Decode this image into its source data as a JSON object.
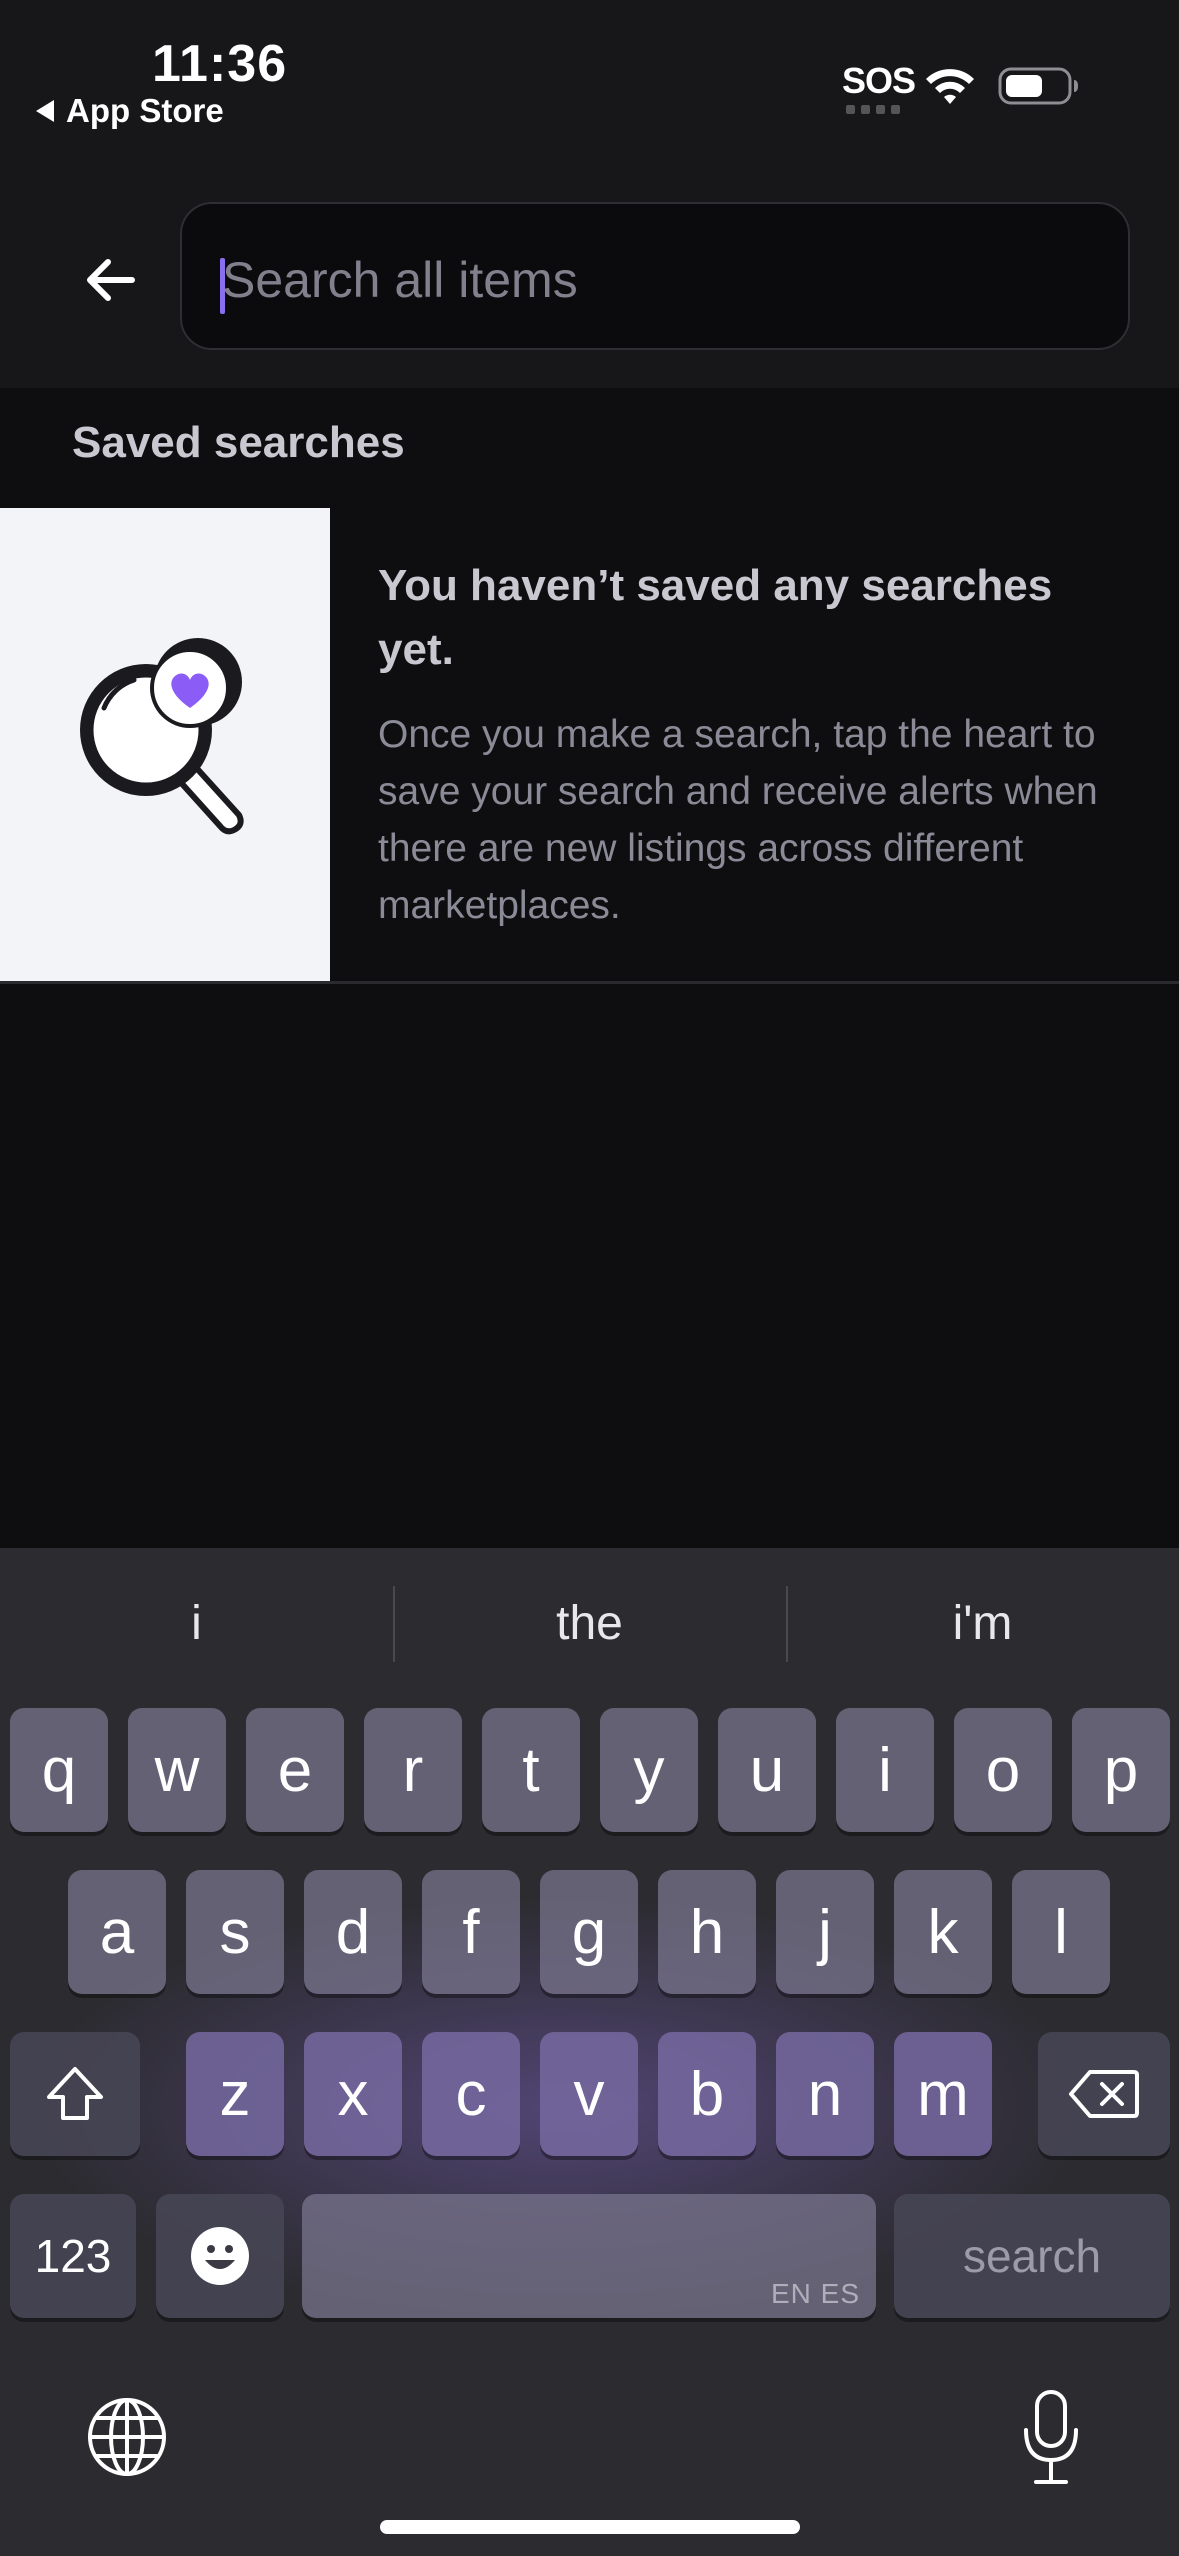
{
  "status_bar": {
    "time": "11:36",
    "back_app": "App Store",
    "sos": "SOS",
    "icons": [
      "wifi-icon",
      "battery-icon"
    ]
  },
  "header": {
    "back_icon": "arrow-left-icon",
    "search_placeholder": "Search all items",
    "search_value": ""
  },
  "saved_searches": {
    "section_title": "Saved searches",
    "empty_title": "You haven’t saved any searches yet.",
    "empty_body": "Once you make a search, tap the heart to save your search and receive alerts when there are new listings across different marketplaces.",
    "illustration": "magnifier-heart-icon"
  },
  "colors": {
    "accent": "#8b6ef0",
    "background": "#0e0e10",
    "header_background": "#17171a",
    "illustration_background": "#f3f4f7"
  },
  "keyboard": {
    "suggestions": [
      "i",
      "the",
      "i'm"
    ],
    "row1": [
      "q",
      "w",
      "e",
      "r",
      "t",
      "y",
      "u",
      "i",
      "o",
      "p"
    ],
    "row2": [
      "a",
      "s",
      "d",
      "f",
      "g",
      "h",
      "j",
      "k",
      "l"
    ],
    "row3": [
      "z",
      "x",
      "c",
      "v",
      "b",
      "n",
      "m"
    ],
    "numbers_key": "123",
    "space_languages": "EN ES",
    "return_key": "search",
    "icons": [
      "shift-icon",
      "delete-icon",
      "emoji-icon",
      "globe-icon",
      "microphone-icon"
    ]
  }
}
